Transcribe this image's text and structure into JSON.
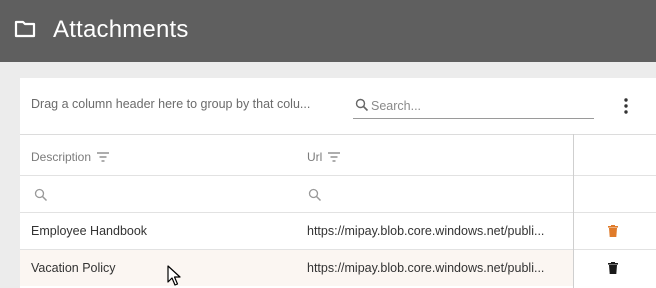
{
  "header": {
    "title": "Attachments",
    "icon": "folder-icon"
  },
  "toolbar": {
    "group_hint": "Drag a column header here to group by that colu...",
    "search_placeholder": "Search..."
  },
  "columns": [
    {
      "label": "Description"
    },
    {
      "label": "Url"
    }
  ],
  "rows": [
    {
      "description": "Employee Handbook",
      "url": "https://mipay.blob.core.windows.net/publi...",
      "delete_color": "#e07b2a"
    },
    {
      "description": "Vacation Policy",
      "url": "https://mipay.blob.core.windows.net/publi...",
      "delete_color": "#1a1a1a"
    }
  ],
  "colors": {
    "header_bg": "#5f5f5f",
    "accent_orange": "#e07b2a"
  }
}
